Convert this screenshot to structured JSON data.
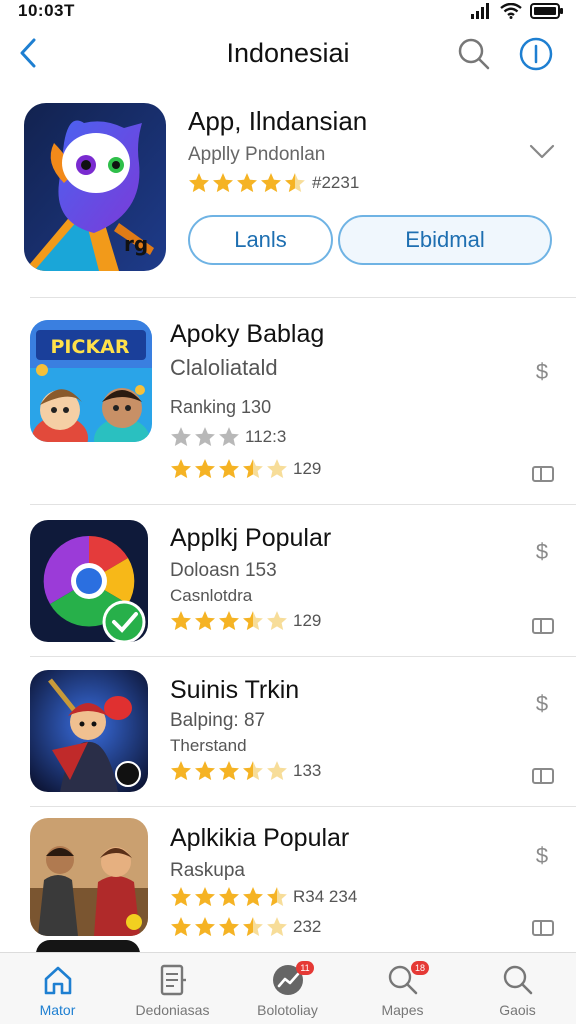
{
  "status_bar": {
    "time": "10:03T"
  },
  "nav": {
    "title": "Indonesiai"
  },
  "featured": {
    "title": "App, Ilndansian",
    "subtitle": "Applly Pndonlan",
    "rating_count": "#2231",
    "rating": 4.5,
    "launch_label": "Lanls",
    "download_label": "Ebidmal"
  },
  "apps": [
    {
      "title": "Apoky Bablag",
      "line1": "Claloliatald",
      "line2": "Ranking 130",
      "gray_stars_count": "112:3",
      "rating_count": "129",
      "rating": 3.5,
      "icon_text": "PICKAR"
    },
    {
      "title": "Applkj Popular",
      "line1": "Doloasn 153",
      "line2": "Casnlotdra",
      "rating_count": "129",
      "rating": 3.5
    },
    {
      "title": "Suinis Trkin",
      "line1": "Balping: 87",
      "line2": "Therstand",
      "rating_count": "133",
      "rating": 3.5
    },
    {
      "title": "Aplkikia Popular",
      "line1": "Raskupa",
      "rating_count_1": "R34 234",
      "rating_count_2": "232",
      "rating_1": 4.5,
      "rating_2": 3.5
    }
  ],
  "price_symbol": "$",
  "tabs": [
    {
      "label": "Mator",
      "icon": "home-icon",
      "active": true
    },
    {
      "label": "Dedoniasas",
      "icon": "document-icon"
    },
    {
      "label": "Bolotoliay",
      "icon": "trending-icon",
      "badge": "11"
    },
    {
      "label": "Mapes",
      "icon": "search-badge-icon",
      "badge": "18"
    },
    {
      "label": "Gaois",
      "icon": "search-icon"
    }
  ],
  "colors": {
    "accent": "#1e7fd1",
    "star": "#f5b324",
    "badge": "#e53935"
  }
}
